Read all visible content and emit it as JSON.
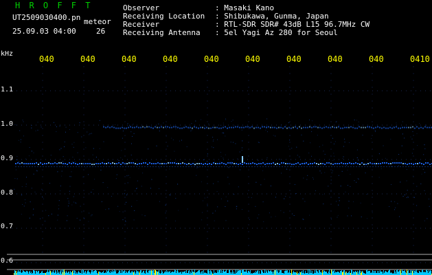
{
  "title": "H R O F F T",
  "file_name": "UT2509030400.pn",
  "meteor_label": "meteor",
  "date_time": "25.09.03 04:00",
  "count": "26",
  "header": [
    {
      "key": "Observer",
      "value": ": Masaki Kano"
    },
    {
      "key": "Receiving Location",
      "value": ": Shibukawa, Gunma, Japan"
    },
    {
      "key": "Receiver",
      "value": ": RTL-SDR SDR# 43dB L15 96.7MHz CW"
    },
    {
      "key": "Receiving Antenna",
      "value": ": 5el Yagi Az 280 for Seoul"
    }
  ],
  "chart_data": {
    "type": "heatmap",
    "ylabel": "kHz",
    "x_ticks": [
      "040",
      "040",
      "040",
      "040",
      "040",
      "040",
      "040",
      "040",
      "040",
      "0410"
    ],
    "y_ticks": [
      "1.1",
      "1.0",
      "0.9",
      "0.8",
      "0.7",
      "0.6"
    ],
    "y_range": [
      0.58,
      1.17
    ],
    "echo_lines_khz": [
      0.89,
      0.995
    ],
    "colors": {
      "background": "#000000",
      "signal": "#1e6cff",
      "bright": "#88ccff",
      "histogram": "#00c8ff"
    }
  }
}
